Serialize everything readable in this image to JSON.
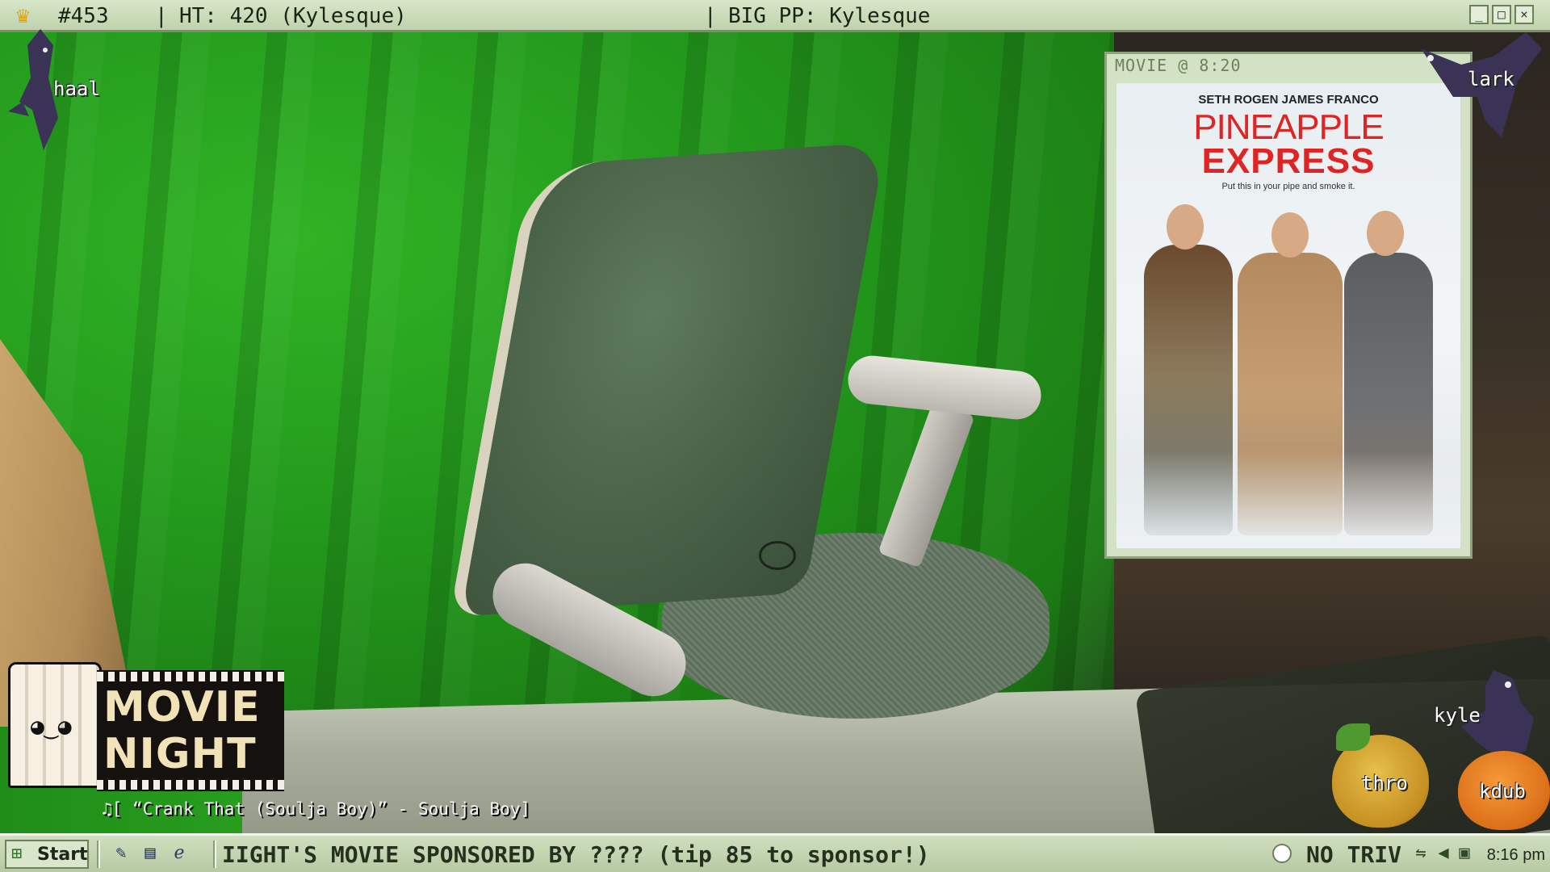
{
  "topbar": {
    "counter": "#453",
    "ht": "HT: 420 (Kylesque)",
    "big_pp": "BIG PP: Kylesque",
    "sep": "|",
    "buttons": {
      "minimize": "_",
      "maximize": "□",
      "close": "×"
    }
  },
  "movie_window": {
    "title": "MOVIE @ 8:20",
    "poster": {
      "actors": "SETH ROGEN   JAMES FRANCO",
      "title_line1": "PINEAPPLE",
      "title_line2": "EXPRESS",
      "tagline": "Put this in your pipe and smoke it."
    }
  },
  "overlay_names": {
    "top_left": "haal",
    "top_right": "lark",
    "bottom_right_crow": "kyle",
    "pumpkin_left": "thro",
    "pumpkin_right": "kdub"
  },
  "movie_night": {
    "line1": "MOVIE",
    "line2": "NIGHT",
    "now_playing": "[ “Crank That (Soulja Boy)” - Soulja Boy]"
  },
  "taskbar": {
    "start_label": "Start",
    "ticker": "IIGHT'S MOVIE SPONSORED BY ???? (tip 85 to sponsor!)",
    "trivia": "NO TRIV",
    "clock": "8:16 pm"
  },
  "icons": {
    "crown": "crown-icon",
    "start": "windows-flag-icon",
    "quick_launch": [
      "notepad-icon",
      "explorer-icon",
      "internet-explorer-icon"
    ],
    "tray": [
      "status-circle-icon",
      "network-icon",
      "volume-icon",
      "display-icon"
    ],
    "music": "music-note-icon"
  }
}
